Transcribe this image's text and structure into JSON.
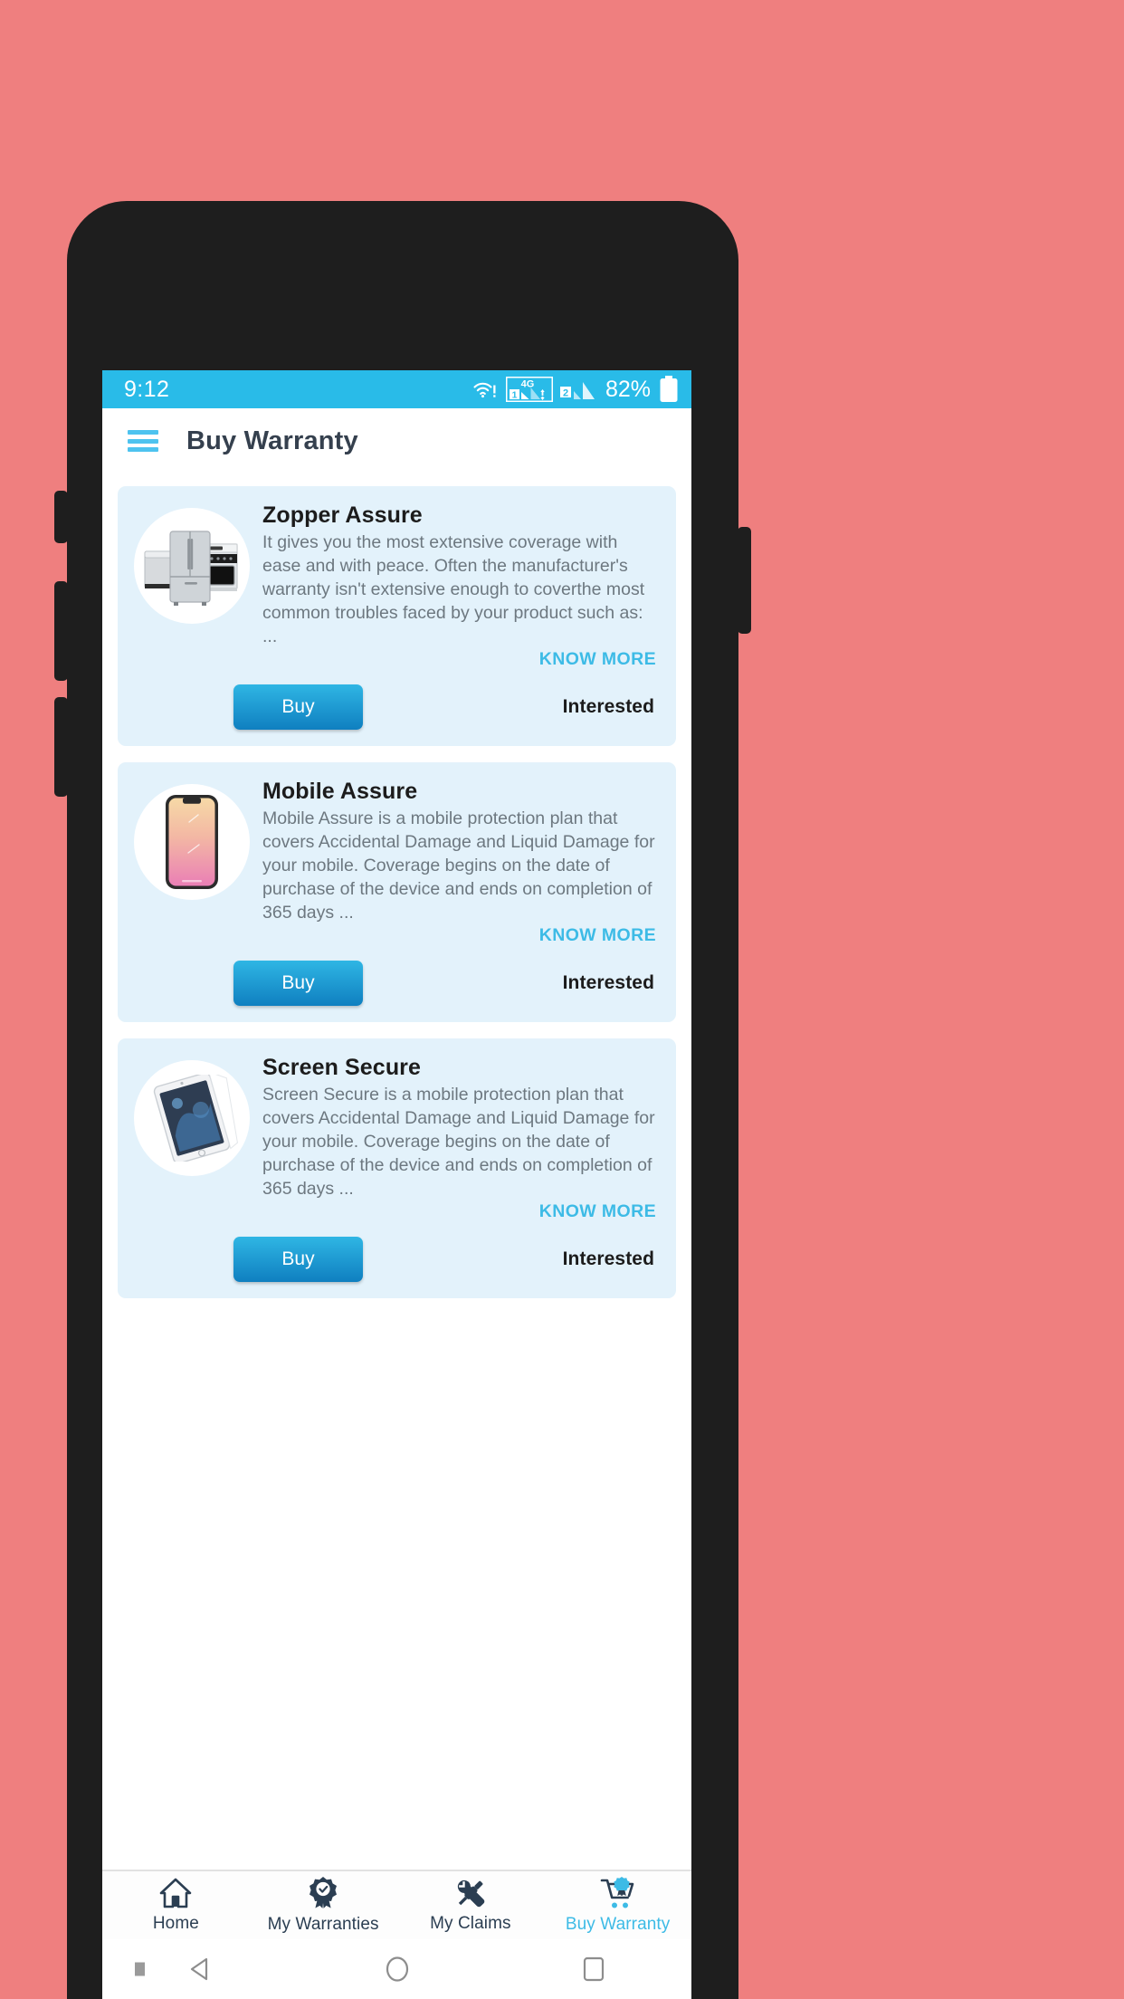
{
  "theme": {
    "outer_background": "#ef7f7f",
    "frame_color": "#1e1e1e",
    "status_bar_color": "#29bbe8",
    "accent_color": "#3dbbe6",
    "card_background": "#e3f2fb",
    "title_color": "#35404e",
    "body_text_color": "#6d7880"
  },
  "status_bar": {
    "time": "9:12",
    "battery_percent": "82%",
    "network_label": "4G",
    "sim1_label": "1",
    "sim2_label": "2",
    "icons": [
      "wifi-alert-icon",
      "signal-4g-sim1-icon",
      "signal-sim2-icon",
      "battery-icon"
    ]
  },
  "app_bar": {
    "menu_icon": "hamburger-icon",
    "title": "Buy Warranty"
  },
  "plans": [
    {
      "name": "Zopper Assure",
      "description": "It gives you the most extensive coverage with ease and with peace. Often the manufacturer's warranty isn't extensive enough to coverthe most common troubles faced by your product such as: ...",
      "know_more_label": "KNOW MORE",
      "buy_label": "Buy",
      "interested_label": "Interested",
      "thumbnail": "home-appliances-icon"
    },
    {
      "name": "Mobile Assure",
      "description": "Mobile Assure is a mobile protection plan that covers Accidental Damage and Liquid Damage for your mobile. Coverage begins on the date of purchase of the device and ends on completion of 365 days ...",
      "know_more_label": "KNOW MORE",
      "buy_label": "Buy",
      "interested_label": "Interested",
      "thumbnail": "smartphone-icon"
    },
    {
      "name": "Screen Secure",
      "description": "Screen Secure is a mobile protection plan that covers Accidental Damage and Liquid Damage for your mobile. Coverage begins on the date of purchase of the device and ends on completion of 365 days ...",
      "know_more_label": "KNOW MORE",
      "buy_label": "Buy",
      "interested_label": "Interested",
      "thumbnail": "tablet-screen-protector-icon"
    }
  ],
  "bottom_nav": {
    "items": [
      {
        "label": "Home",
        "icon": "home-icon",
        "active": false
      },
      {
        "label": "My Warranties",
        "icon": "award-ribbon-icon",
        "active": false
      },
      {
        "label": "My Claims",
        "icon": "wrench-screwdriver-icon",
        "active": false
      },
      {
        "label": "Buy Warranty",
        "icon": "shopping-cart-award-icon",
        "active": true
      }
    ]
  },
  "system_nav": {
    "buttons": [
      "back-triangle-icon",
      "home-circle-icon",
      "recents-square-icon"
    ]
  }
}
